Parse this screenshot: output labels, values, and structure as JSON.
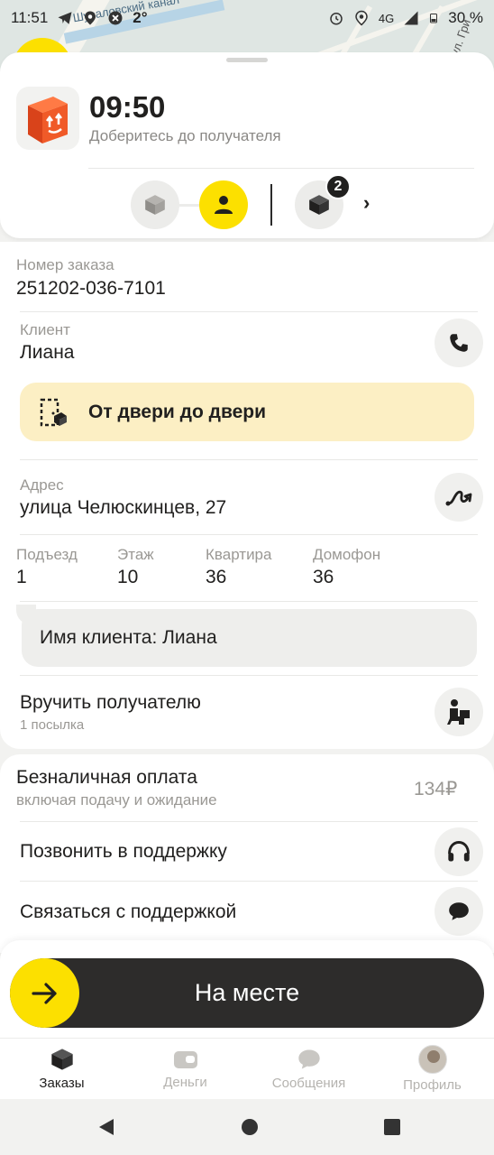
{
  "status_bar": {
    "time": "11:51",
    "temperature": "2°",
    "network": "4G",
    "battery": "30 %"
  },
  "map": {
    "street_label": "Шуваловский канал",
    "corner_label": "ул. Гри"
  },
  "header": {
    "eta_time": "09:50",
    "eta_subtitle": "Доберитесь до получателя",
    "stepper": {
      "badge_count": "2",
      "chevron": "›"
    }
  },
  "order": {
    "number_label": "Номер заказа",
    "number_value": "251202-036-7101",
    "client_label": "Клиент",
    "client_value": "Лиана",
    "delivery_type": "От двери до двери",
    "address_label": "Адрес",
    "address_value": "улица Челюскинцев, 27",
    "details": [
      {
        "label": "Подъезд",
        "value": "1"
      },
      {
        "label": "Этаж",
        "value": "10"
      },
      {
        "label": "Квартира",
        "value": "36"
      },
      {
        "label": "Домофон",
        "value": "36"
      }
    ],
    "comment": "Имя клиента: Лиана",
    "handover_title": "Вручить получателю",
    "handover_sub": "1 посылка"
  },
  "payment": {
    "title": "Безналичная оплата",
    "subtitle": "включая подачу и ожидание",
    "amount": "134₽",
    "call_support": "Позвонить в поддержку",
    "contact_support": "Связаться с поддержкой"
  },
  "action": {
    "swipe_label": "На месте"
  },
  "tabs": [
    {
      "label": "Заказы",
      "icon": "box-icon",
      "active": true
    },
    {
      "label": "Деньги",
      "icon": "wallet-icon",
      "active": false
    },
    {
      "label": "Сообщения",
      "icon": "chat-icon",
      "active": false
    },
    {
      "label": "Профиль",
      "icon": "avatar",
      "active": false
    }
  ],
  "colors": {
    "accent": "#fce000",
    "dark": "#21201f",
    "door_banner": "#fcefc4",
    "box_orange": "#f05a28"
  }
}
